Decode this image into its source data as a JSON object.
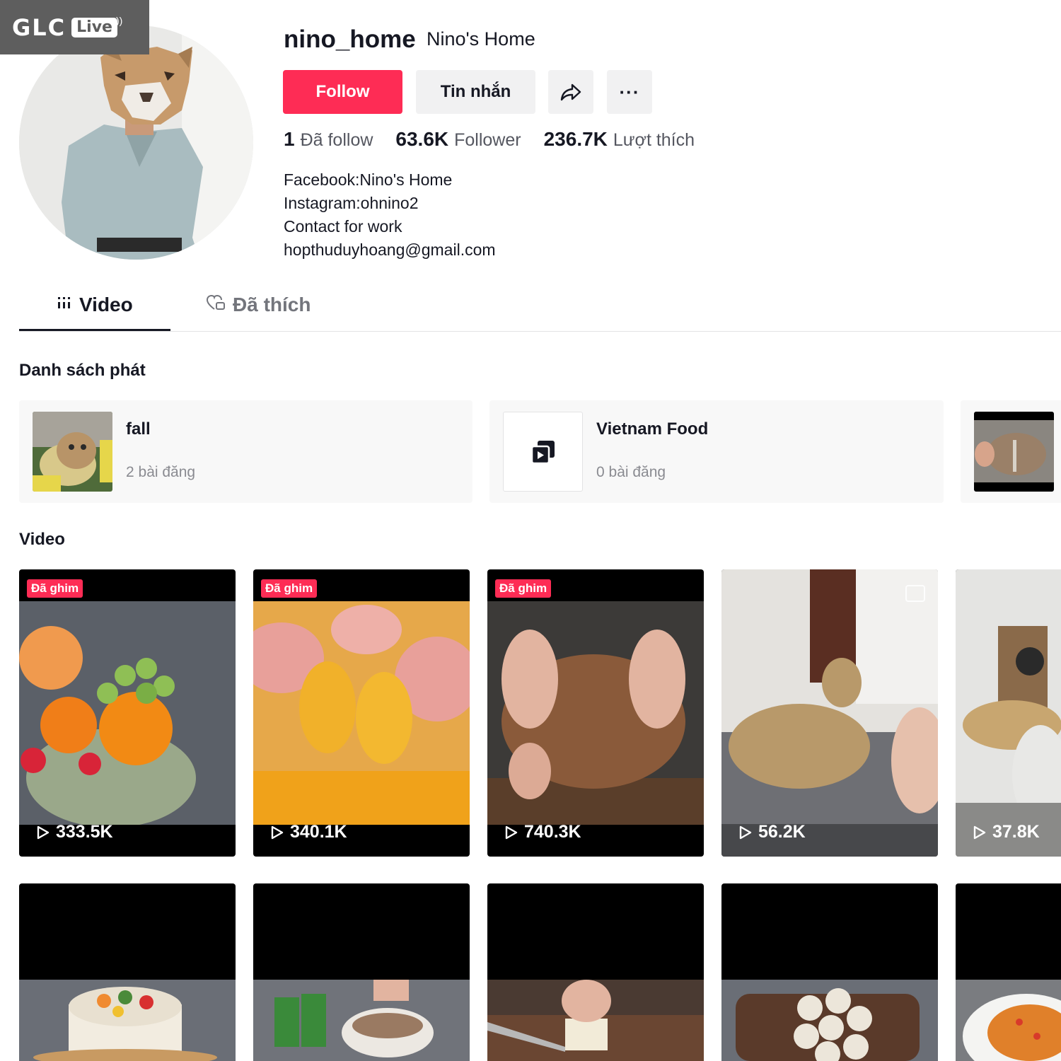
{
  "watermark": {
    "brand": "GLC",
    "badge": "Live"
  },
  "profile": {
    "username": "nino_home",
    "nickname": "Nino's Home",
    "follow_label": "Follow",
    "message_label": "Tin nhắn",
    "more_label": "···",
    "stats": [
      {
        "value": "1",
        "label": "Đã follow"
      },
      {
        "value": "63.6K",
        "label": "Follower"
      },
      {
        "value": "236.7K",
        "label": "Lượt thích"
      }
    ],
    "bio": [
      "Facebook:Nino's Home",
      "Instagram:ohnino2",
      "Contact for work",
      "hopthuduyhoang@gmail.com"
    ]
  },
  "tabs": [
    {
      "label": "Video",
      "icon": "grid-icon",
      "active": true
    },
    {
      "label": "Đã thích",
      "icon": "liked-heart-icon",
      "active": false
    }
  ],
  "playlists_title": "Danh sách phát",
  "playlists": [
    {
      "name": "fall",
      "count": "2 bài đăng"
    },
    {
      "name": "Vietnam Food",
      "count": "0 bài đăng"
    }
  ],
  "videos_title": "Video",
  "videos_row1": [
    {
      "pinned": "Đã ghim",
      "views": "333.5K"
    },
    {
      "pinned": "Đã ghim",
      "views": "340.1K"
    },
    {
      "pinned": "Đã ghim",
      "views": "740.3K"
    },
    {
      "pinned": "",
      "views": "56.2K"
    },
    {
      "pinned": "",
      "views": "37.8K"
    }
  ],
  "colors": {
    "accent": "#fe2c55",
    "button_bg": "#f1f1f2",
    "text": "#161823",
    "muted": "#73757c"
  }
}
